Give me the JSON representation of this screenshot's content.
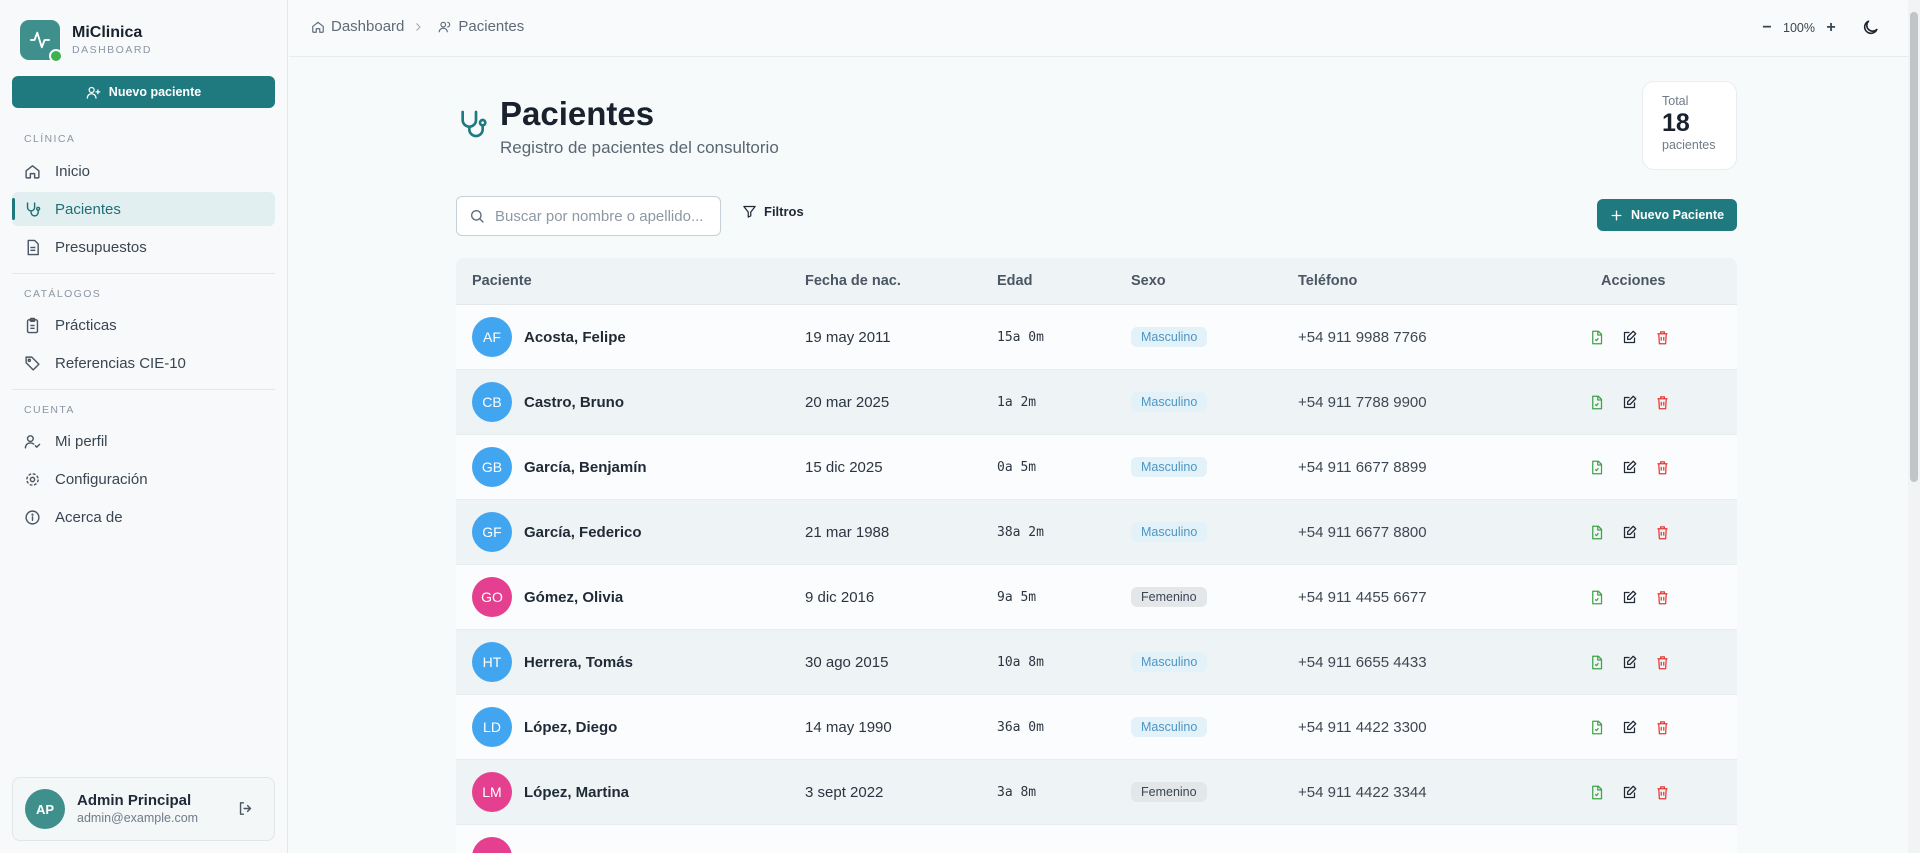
{
  "sidebar": {
    "brand_name": "MiClinica",
    "brand_sub": "DASHBOARD",
    "new_patient_label": "Nuevo paciente",
    "sections": {
      "clinica": "CLÍNICA",
      "catalogos": "CATÁLOGOS",
      "cuenta": "CUENTA"
    },
    "items": {
      "inicio": "Inicio",
      "pacientes": "Pacientes",
      "presupuestos": "Presupuestos",
      "practicas": "Prácticas",
      "cie10": "Referencias CIE-10",
      "perfil": "Mi perfil",
      "config": "Configuración",
      "acerca": "Acerca de"
    },
    "active_item": "Pacientes",
    "user": {
      "initials": "AP",
      "name": "Admin Principal",
      "email": "admin@example.com"
    }
  },
  "topbar": {
    "breadcrumb": [
      "Dashboard",
      "Pacientes"
    ],
    "zoom": "100%",
    "zoom_out": "−",
    "zoom_in": "+"
  },
  "page": {
    "title": "Pacientes",
    "subtitle": "Registro de pacientes del consultorio",
    "total_label": "Total",
    "total_count": "18",
    "total_unit": "pacientes"
  },
  "toolbar": {
    "search_placeholder": "Buscar por nombre o apellido...",
    "filters_label": "Filtros",
    "new_button_label": "Nuevo Paciente"
  },
  "table": {
    "headers": {
      "patient": "Paciente",
      "birth": "Fecha de nac.",
      "age": "Edad",
      "sex": "Sexo",
      "phone": "Teléfono",
      "actions": "Acciones"
    },
    "rows": [
      {
        "initials": "AF",
        "name": "Acosta, Felipe",
        "birth": "19 may 2011",
        "age": "15a 0m",
        "sex": "Masculino",
        "phone": "+54 911 9988 7766"
      },
      {
        "initials": "CB",
        "name": "Castro, Bruno",
        "birth": "20 mar 2025",
        "age": "1a 2m",
        "sex": "Masculino",
        "phone": "+54 911 7788 9900"
      },
      {
        "initials": "GB",
        "name": "García, Benjamín",
        "birth": "15 dic 2025",
        "age": "0a 5m",
        "sex": "Masculino",
        "phone": "+54 911 6677 8899"
      },
      {
        "initials": "GF",
        "name": "García, Federico",
        "birth": "21 mar 1988",
        "age": "38a 2m",
        "sex": "Masculino",
        "phone": "+54 911 6677 8800"
      },
      {
        "initials": "GO",
        "name": "Gómez, Olivia",
        "birth": "9 dic 2016",
        "age": "9a 5m",
        "sex": "Femenino",
        "phone": "+54 911 4455 6677"
      },
      {
        "initials": "HT",
        "name": "Herrera, Tomás",
        "birth": "30 ago 2015",
        "age": "10a 8m",
        "sex": "Masculino",
        "phone": "+54 911 6655 4433"
      },
      {
        "initials": "LD",
        "name": "López, Diego",
        "birth": "14 may 1990",
        "age": "36a 0m",
        "sex": "Masculino",
        "phone": "+54 911 4422 3300"
      },
      {
        "initials": "LM",
        "name": "López, Martina",
        "birth": "3 sept 2022",
        "age": "3a 8m",
        "sex": "Femenino",
        "phone": "+54 911 4422 3344"
      }
    ]
  },
  "colors": {
    "primary": "#1f7a80",
    "male_avatar": "#42a5f0",
    "female_avatar": "#e5408f",
    "export": "#3fa24a",
    "delete": "#e53935"
  }
}
